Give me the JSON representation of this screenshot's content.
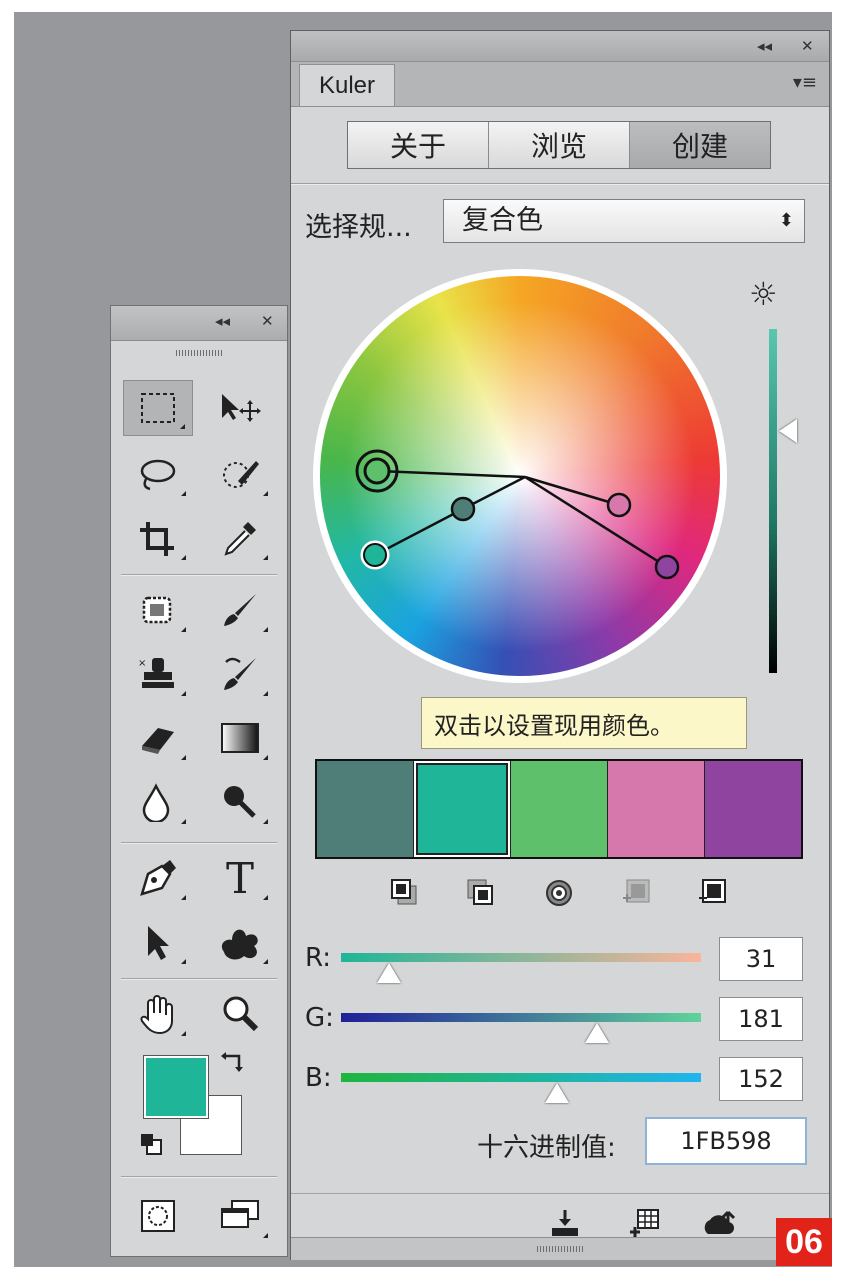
{
  "toolbox": {
    "collapse_label": "◂◂",
    "close_label": "✕",
    "tools": [
      {
        "name": "rectangular-marquee-tool",
        "selected": true
      },
      {
        "name": "move-tool"
      },
      {
        "name": "lasso-tool"
      },
      {
        "name": "quick-selection-tool"
      },
      {
        "name": "crop-tool"
      },
      {
        "name": "eyedropper-tool"
      },
      {
        "name": "spot-healing-brush-tool"
      },
      {
        "name": "brush-tool"
      },
      {
        "name": "clone-stamp-tool"
      },
      {
        "name": "history-brush-tool"
      },
      {
        "name": "eraser-tool"
      },
      {
        "name": "gradient-tool"
      },
      {
        "name": "blur-tool"
      },
      {
        "name": "dodge-tool"
      },
      {
        "name": "pen-tool"
      },
      {
        "name": "type-tool"
      },
      {
        "name": "path-selection-tool"
      },
      {
        "name": "custom-shape-tool"
      },
      {
        "name": "hand-tool"
      },
      {
        "name": "zoom-tool"
      }
    ],
    "type_tool_glyph": "T",
    "foreground_color": "#1fb598",
    "background_color": "#ffffff"
  },
  "kuler": {
    "collapse_label": "◂◂",
    "close_label": "✕",
    "tab_label": "Kuler",
    "menu_icon": "▾≡",
    "segments": [
      "关于",
      "浏览",
      "创建"
    ],
    "active_segment": "创建",
    "rule_label": "选择规...",
    "rule_value": "复合色",
    "rule_arrows": "⬍",
    "brightness_icon": "☼",
    "tooltip": "双击以设置现用颜色。",
    "swatches": [
      "#4f7e78",
      "#1fb598",
      "#5fc06b",
      "#d778ad",
      "#8f45a0"
    ],
    "active_swatch_index": 1,
    "sliders": {
      "r_label": "R:",
      "r_value": "31",
      "g_label": "G:",
      "g_value": "181",
      "b_label": "B:",
      "b_value": "152"
    },
    "hex_label": "十六进制值:",
    "hex_value": "1FB598",
    "colors": {
      "r_track_start": "#1fb598",
      "r_track_end": "#f9b59a",
      "g_track_start": "#201f98",
      "g_track_end": "#5fd39a",
      "b_track_start": "#1fb53e",
      "b_track_end": "#1fb5f0"
    }
  },
  "badge": "06"
}
